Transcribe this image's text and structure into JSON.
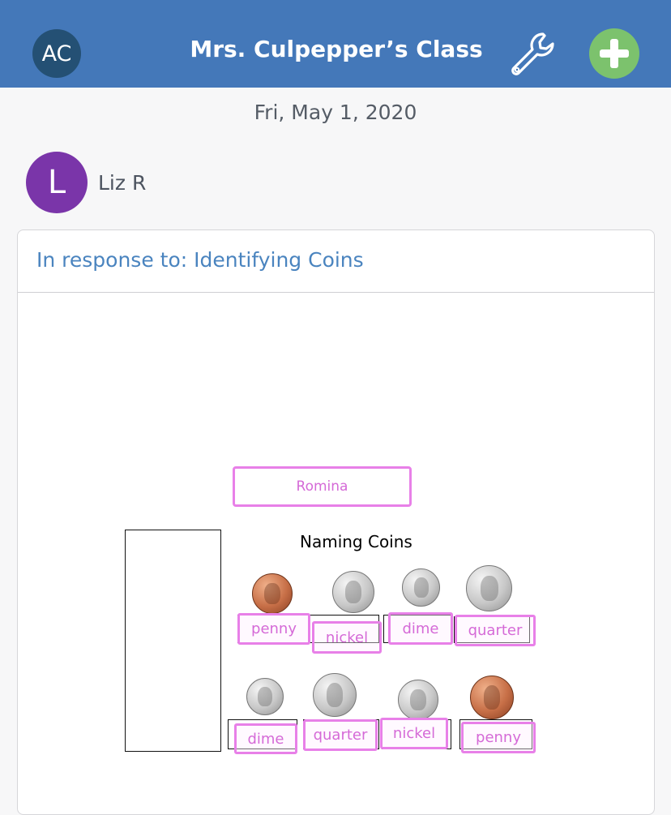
{
  "header": {
    "user_initials": "AC",
    "class_title": "Mrs. Culpepper’s Class",
    "settings_icon": "wrench-icon",
    "add_icon": "plus-icon",
    "colors": {
      "bar": "#4478b9",
      "add_button": "#7cc26d",
      "avatar": "#245074"
    }
  },
  "date": "Fri, May 1, 2020",
  "post": {
    "author_initial": "L",
    "author_name": "Liz R",
    "avatar_color": "#7a35a9",
    "response_title": "In response to: Identifying Coins"
  },
  "worksheet": {
    "student_name": "Romina",
    "title": "Naming Coins",
    "row1": [
      {
        "coin": "penny-coin",
        "answer": "penny"
      },
      {
        "coin": "nickel-coin",
        "answer": "nickel"
      },
      {
        "coin": "dime-coin",
        "answer": "dime"
      },
      {
        "coin": "quarter-coin",
        "answer": "quarter"
      }
    ],
    "row2": [
      {
        "coin": "dime-coin",
        "answer": "dime"
      },
      {
        "coin": "quarter-coin",
        "answer": "quarter"
      },
      {
        "coin": "nickel-coin",
        "answer": "nickel"
      },
      {
        "coin": "penny-coin",
        "answer": "penny"
      }
    ]
  }
}
